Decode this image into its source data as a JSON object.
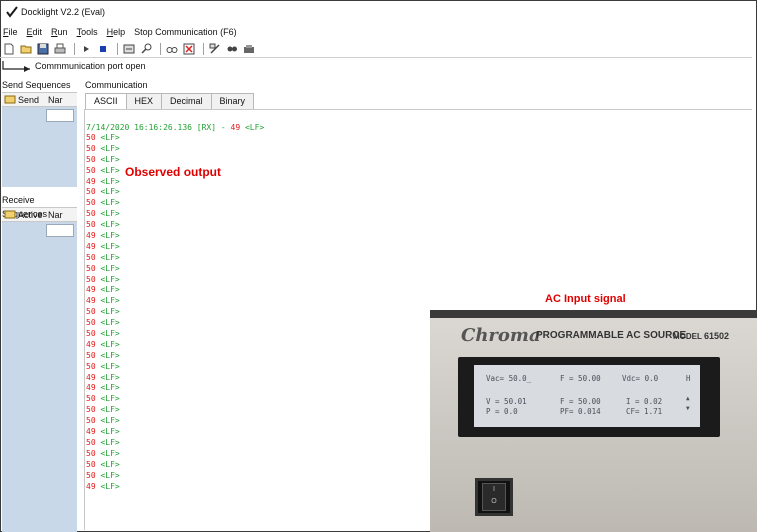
{
  "window": {
    "title": "Docklight V2.2 (Eval)"
  },
  "menu": [
    {
      "key": "F",
      "rest": "ile"
    },
    {
      "key": "E",
      "rest": "dit"
    },
    {
      "key": "R",
      "rest": "un"
    },
    {
      "key": "T",
      "rest": "ools"
    },
    {
      "key": "H",
      "rest": "elp"
    },
    {
      "key": "",
      "rest": "Stop Communication  (F6)"
    }
  ],
  "status": {
    "port_message": "Commmunication port open"
  },
  "send_sequences": {
    "title": "Send Sequences",
    "col_send": "Send",
    "col_name": "Nar"
  },
  "receive_sequences": {
    "title": "Receive Sequences",
    "col_active": "Active",
    "col_name": "Nar"
  },
  "communication": {
    "label": "Communication",
    "tabs": [
      "ASCII",
      "HEX",
      "Decimal",
      "Binary"
    ],
    "active_tab": "ASCII"
  },
  "log": {
    "header_timestamp": "7/14/2020 16:16:26.136 [RX] - ",
    "header_value": "49",
    "header_lf": " <LF>",
    "lf_token": "<LF>",
    "values": [
      "50",
      "50",
      "50",
      "50",
      "49",
      "50",
      "50",
      "50",
      "50",
      "49",
      "49",
      "50",
      "50",
      "50",
      "49",
      "49",
      "50",
      "50",
      "50",
      "49",
      "50",
      "50",
      "49",
      "49",
      "50",
      "50",
      "50",
      "49",
      "50",
      "50",
      "50",
      "50",
      "49"
    ]
  },
  "annotations": {
    "observed": "Observed output",
    "ac_input": "AC Input signal"
  },
  "device": {
    "brand": "Chroma",
    "product": "PROGRAMMABLE AC SOURCE",
    "model_label": "MODEL",
    "model_number": "61502",
    "lcd": {
      "r1a": "Vac= 50.0_",
      "r1b": "F = 50.00",
      "r1c": "Vdc= 0.0",
      "r1d": "H",
      "r2a": "V = 50.01",
      "r2b": "F = 50.00",
      "r2c": "I = 0.02",
      "r3a": "P = 0.0",
      "r3b": "PF= 0.014",
      "r3c": "CF= 1.71"
    },
    "switch_on": "I",
    "switch_off": "O"
  },
  "colors": {
    "rx_value": "#e01b1b",
    "lf": "#22a033",
    "annotation": "#e00000",
    "panel": "#c9d8e8"
  }
}
